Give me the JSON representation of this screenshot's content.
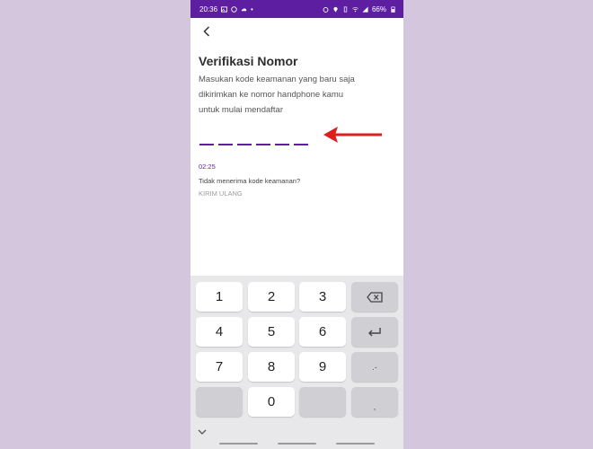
{
  "status_bar": {
    "time": "20:36",
    "battery": "66%"
  },
  "screen": {
    "title": "Verifikasi Nomor",
    "description_lines": [
      "Masukan kode keamanan yang baru saja",
      "dikirimkan ke nomor handphone kamu",
      "untuk mulai mendaftar"
    ],
    "otp_length": 6,
    "timer": "02:25",
    "no_receive_text": "Tidak menerima kode keamanan?",
    "resend_label": "KIRIM ULANG"
  },
  "keyboard": {
    "keys": [
      "1",
      "2",
      "3",
      "4",
      "5",
      "6",
      "7",
      "8",
      "9",
      "0"
    ],
    "symbol_key": ".-",
    "comma_key": ","
  },
  "colors": {
    "accent": "#5e1ea1",
    "annotation_arrow": "#e01e1e",
    "page_background": "#d3c6dd"
  },
  "icons": {
    "back": "back-arrow-icon",
    "backspace": "backspace-icon",
    "enter": "enter-icon",
    "hide_keyboard": "chevron-down-icon"
  }
}
